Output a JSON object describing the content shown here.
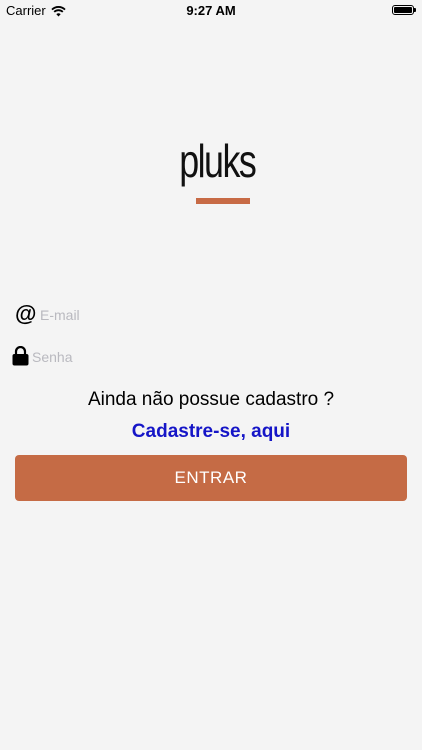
{
  "status_bar": {
    "carrier": "Carrier",
    "time": "9:27 AM"
  },
  "brand": {
    "logo_text": "pluks",
    "accent_color": "#c76a45"
  },
  "login_form": {
    "email_placeholder": "E-mail",
    "password_placeholder": "Senha",
    "signup_question": "Ainda não possue cadastro ?",
    "signup_link": "Cadastre-se, aqui",
    "submit_label": "ENTRAR",
    "submit_color": "#c56b45",
    "link_color": "#1515c7"
  },
  "icons": {
    "email_icon": "at-icon",
    "password_icon": "lock-icon",
    "wifi_icon": "wifi-icon",
    "battery_icon": "battery-icon"
  }
}
